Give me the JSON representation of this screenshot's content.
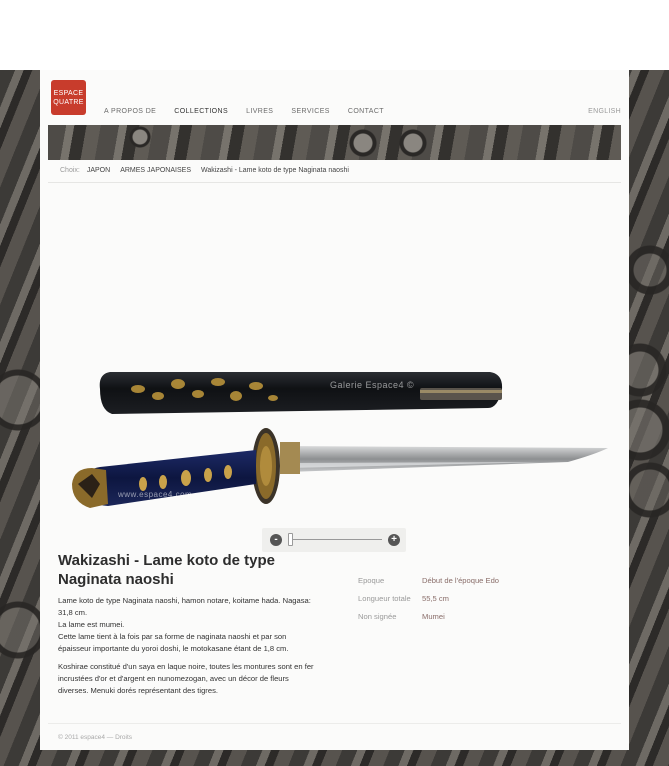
{
  "brand": {
    "logo_line1": "ESPACE",
    "logo_line2": "QUATRE"
  },
  "nav": {
    "items": [
      {
        "label": "A PROPOS DE"
      },
      {
        "label": "COLLECTIONS"
      },
      {
        "label": "LIVRES"
      },
      {
        "label": "SERVICES"
      },
      {
        "label": "CONTACT"
      }
    ],
    "language": "ENGLISH"
  },
  "breadcrumb": {
    "label": "Choix:",
    "items": [
      "JAPON",
      "ARMES JAPONAISES",
      "Wakizashi - Lame koto de type Naginata naoshi"
    ]
  },
  "image": {
    "watermark1": "Galerie Espace4 ©",
    "watermark2": "www.espace4.com"
  },
  "zoom": {
    "minus": "-",
    "plus": "+",
    "level": 0.0
  },
  "product": {
    "title": "Wakizashi - Lame koto de type Naginata naoshi",
    "description": [
      "Lame koto de type Naginata naoshi, hamon notare, koitame hada. Nagasa: 31,8 cm.",
      "La lame est mumei.",
      "Cette lame tient à la fois par sa forme de naginata naoshi et par son épaisseur importante du yoroi doshi, le motokasane étant de 1,8 cm.",
      "Koshirae constitué d'un saya en laque noire, toutes les montures sont en fer incrustées d'or et d'argent en nunomezogan, avec un décor de fleurs diverses. Menuki dorés représentant des tigres."
    ],
    "specs": [
      {
        "key": "Epoque",
        "value": "Début de l'époque Edo"
      },
      {
        "key": "Longueur totale",
        "value": "55,5 cm"
      },
      {
        "key": "Non signée",
        "value": "Mumei"
      }
    ]
  },
  "footer": {
    "text": "© 2011 espace4 — Droits"
  },
  "colors": {
    "accent": "#c83c2c",
    "spec_value": "#8a6e6a"
  }
}
